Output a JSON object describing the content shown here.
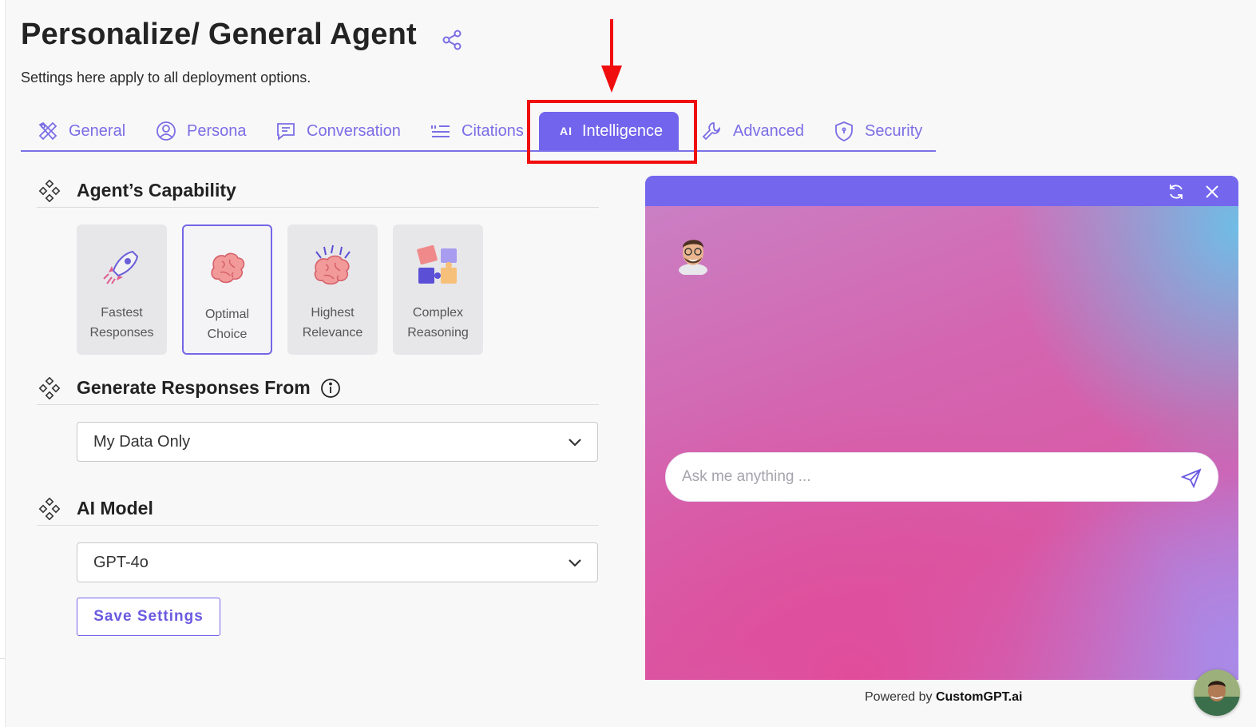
{
  "header": {
    "title": "Personalize/ General Agent",
    "subtitle": "Settings here apply to all deployment options."
  },
  "tabs": [
    {
      "label": "General",
      "icon": "tools-icon",
      "active": false
    },
    {
      "label": "Persona",
      "icon": "user-circle-icon",
      "active": false
    },
    {
      "label": "Conversation",
      "icon": "chat-icon",
      "active": false
    },
    {
      "label": "Citations",
      "icon": "quote-list-icon",
      "active": false
    },
    {
      "label": "Intelligence",
      "icon": "ai-icon",
      "active": true
    },
    {
      "label": "Advanced",
      "icon": "wrench-icon",
      "active": false
    },
    {
      "label": "Security",
      "icon": "shield-icon",
      "active": false
    }
  ],
  "ai_badge": "AI",
  "capability": {
    "title": "Agent’s Capability",
    "cards": [
      {
        "line1": "Fastest",
        "line2": "Responses",
        "icon": "rocket-icon",
        "selected": false
      },
      {
        "line1": "Optimal",
        "line2": "Choice",
        "icon": "brain-icon",
        "selected": true
      },
      {
        "line1": "Highest",
        "line2": "Relevance",
        "icon": "sparkling-brain-icon",
        "selected": false
      },
      {
        "line1": "Complex",
        "line2": "Reasoning",
        "icon": "puzzle-icon",
        "selected": false
      }
    ]
  },
  "responses": {
    "title": "Generate Responses From",
    "selected": "My Data Only"
  },
  "model": {
    "title": "AI Model",
    "selected": "GPT-4o"
  },
  "save_label": "Save Settings",
  "chat": {
    "placeholder": "Ask me anything ...",
    "powered_prefix": "Powered by",
    "powered_brand": "CustomGPT.ai"
  },
  "colors": {
    "accent": "#7264ec",
    "highlight": "#f00d0d",
    "chat_bar": "#7467ee"
  }
}
